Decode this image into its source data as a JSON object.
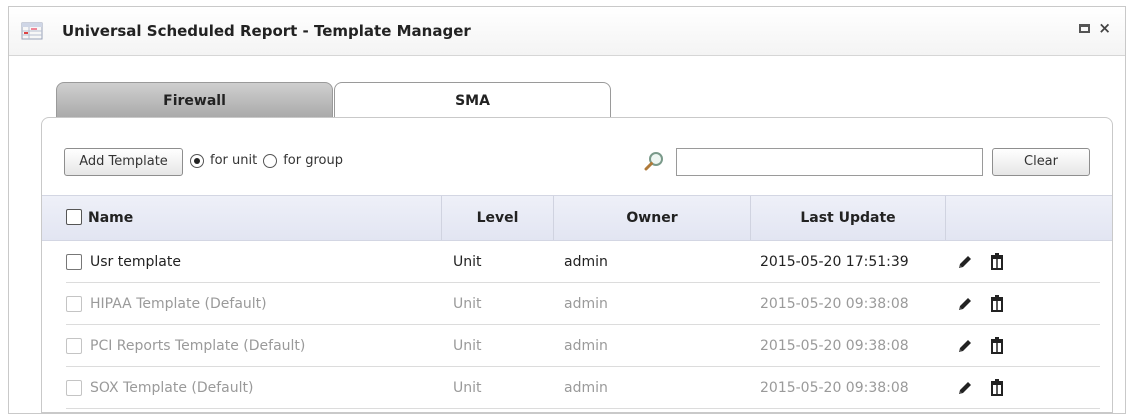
{
  "window": {
    "title": "Universal Scheduled Report - Template Manager",
    "controls": [
      "maximize-icon",
      "close-icon"
    ],
    "close_glyph": "×"
  },
  "tabs": [
    {
      "label": "Firewall",
      "active": false
    },
    {
      "label": "SMA",
      "active": true
    }
  ],
  "toolbar": {
    "add_label": "Add Template",
    "radio_unit_label": "for unit",
    "radio_group_label": "for group",
    "selected_radio": "for unit",
    "search_value": "",
    "search_placeholder": "",
    "clear_label": "Clear"
  },
  "table": {
    "columns": [
      "Name",
      "Level",
      "Owner",
      "Last Update",
      ""
    ],
    "rows": [
      {
        "name": "Usr template",
        "level": "Unit",
        "owner": "admin",
        "last_update": "2015-05-20 17:51:39",
        "default": false
      },
      {
        "name": "HIPAA Template (Default)",
        "level": "Unit",
        "owner": "admin",
        "last_update": "2015-05-20 09:38:08",
        "default": true
      },
      {
        "name": "PCI Reports Template (Default)",
        "level": "Unit",
        "owner": "admin",
        "last_update": "2015-05-20 09:38:08",
        "default": true
      },
      {
        "name": "SOX Template (Default)",
        "level": "Unit",
        "owner": "admin",
        "last_update": "2015-05-20 09:38:08",
        "default": true
      }
    ],
    "row_actions": [
      "pencil-icon",
      "trash-icon"
    ]
  },
  "colors": {
    "header_bg": "#e6e9f4",
    "muted_text": "#9a9a9a",
    "tab_inactive": "#b9b9b9"
  }
}
